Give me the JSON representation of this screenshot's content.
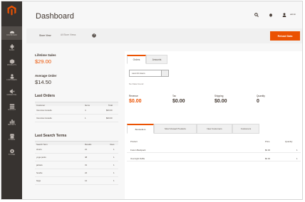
{
  "nav": {
    "items": [
      {
        "label": "DASHBOARD",
        "icon": "dashboard-icon"
      },
      {
        "label": "SALES",
        "icon": "dollar-icon"
      },
      {
        "label": "PRODUCTS",
        "icon": "cube-icon"
      },
      {
        "label": "CUSTOMERS",
        "icon": "person-icon"
      },
      {
        "label": "MARKETING",
        "icon": "megaphone-icon"
      },
      {
        "label": "CONTENT",
        "icon": "layout-icon"
      },
      {
        "label": "REPORTS",
        "icon": "bar-chart-icon"
      },
      {
        "label": "STORES",
        "icon": "store-icon"
      },
      {
        "label": "SYSTEM",
        "icon": "gear-icon"
      }
    ]
  },
  "header": {
    "title": "Dashboard",
    "user": "admin"
  },
  "toolbar": {
    "scope_label": "Store View:",
    "scope_value": "All Store Views",
    "reload_label": "Reload Data"
  },
  "stats": {
    "lifetime_sales_label": "Lifetime Sales",
    "lifetime_sales_value": "$29.00",
    "average_order_label": "Average Order",
    "average_order_value": "$14.50"
  },
  "last_orders": {
    "title": "Last Orders",
    "columns": [
      "Customer",
      "Items",
      "Total"
    ],
    "rows": [
      [
        "Veronica Costello",
        "4",
        "$00.00"
      ],
      [
        "Veronica Costello",
        "1",
        "$00.00"
      ]
    ]
  },
  "search_terms": {
    "title": "Last Search Terms",
    "columns": [
      "Search Term",
      "Results",
      "Uses"
    ],
    "rows": [
      [
        "shorts",
        "21",
        "1"
      ],
      [
        "yoga pants",
        "48",
        "1"
      ],
      [
        "jackets",
        "31",
        "1"
      ],
      [
        "hoodie",
        "24",
        "1"
      ],
      [
        "bags",
        "14",
        "1"
      ]
    ]
  },
  "chart_tabs": [
    "Orders",
    "Amounts"
  ],
  "period": {
    "value": "Last 24 Hours"
  },
  "no_data": "No Data Found",
  "kpis": [
    {
      "label": "Revenue",
      "value": "$0.00"
    },
    {
      "label": "Tax",
      "value": "$0.00"
    },
    {
      "label": "Shipping",
      "value": "$0.00"
    },
    {
      "label": "Quantity",
      "value": "0"
    }
  ],
  "grid_tabs": [
    "Bestsellers",
    "Most Viewed Products",
    "New Customers",
    "Customers"
  ],
  "grid": {
    "columns": [
      "Product",
      "Price",
      "Quantity"
    ],
    "rows": [
      [
        "Fusion Backpack",
        "$0.00",
        "1"
      ],
      [
        "Overnight Duffle",
        "$0.00",
        "1"
      ]
    ]
  },
  "colors": {
    "accent": "#eb5202",
    "sidebar": "#373330"
  }
}
